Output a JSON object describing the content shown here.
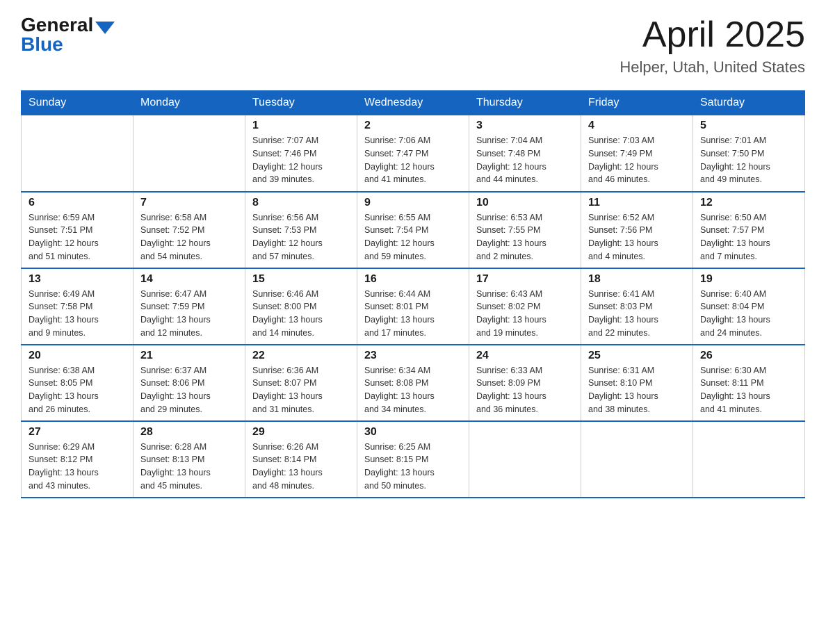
{
  "logo": {
    "general": "General",
    "blue": "Blue"
  },
  "title": {
    "month": "April 2025",
    "location": "Helper, Utah, United States"
  },
  "weekdays": [
    "Sunday",
    "Monday",
    "Tuesday",
    "Wednesday",
    "Thursday",
    "Friday",
    "Saturday"
  ],
  "weeks": [
    [
      {
        "day": "",
        "info": ""
      },
      {
        "day": "",
        "info": ""
      },
      {
        "day": "1",
        "info": "Sunrise: 7:07 AM\nSunset: 7:46 PM\nDaylight: 12 hours\nand 39 minutes."
      },
      {
        "day": "2",
        "info": "Sunrise: 7:06 AM\nSunset: 7:47 PM\nDaylight: 12 hours\nand 41 minutes."
      },
      {
        "day": "3",
        "info": "Sunrise: 7:04 AM\nSunset: 7:48 PM\nDaylight: 12 hours\nand 44 minutes."
      },
      {
        "day": "4",
        "info": "Sunrise: 7:03 AM\nSunset: 7:49 PM\nDaylight: 12 hours\nand 46 minutes."
      },
      {
        "day": "5",
        "info": "Sunrise: 7:01 AM\nSunset: 7:50 PM\nDaylight: 12 hours\nand 49 minutes."
      }
    ],
    [
      {
        "day": "6",
        "info": "Sunrise: 6:59 AM\nSunset: 7:51 PM\nDaylight: 12 hours\nand 51 minutes."
      },
      {
        "day": "7",
        "info": "Sunrise: 6:58 AM\nSunset: 7:52 PM\nDaylight: 12 hours\nand 54 minutes."
      },
      {
        "day": "8",
        "info": "Sunrise: 6:56 AM\nSunset: 7:53 PM\nDaylight: 12 hours\nand 57 minutes."
      },
      {
        "day": "9",
        "info": "Sunrise: 6:55 AM\nSunset: 7:54 PM\nDaylight: 12 hours\nand 59 minutes."
      },
      {
        "day": "10",
        "info": "Sunrise: 6:53 AM\nSunset: 7:55 PM\nDaylight: 13 hours\nand 2 minutes."
      },
      {
        "day": "11",
        "info": "Sunrise: 6:52 AM\nSunset: 7:56 PM\nDaylight: 13 hours\nand 4 minutes."
      },
      {
        "day": "12",
        "info": "Sunrise: 6:50 AM\nSunset: 7:57 PM\nDaylight: 13 hours\nand 7 minutes."
      }
    ],
    [
      {
        "day": "13",
        "info": "Sunrise: 6:49 AM\nSunset: 7:58 PM\nDaylight: 13 hours\nand 9 minutes."
      },
      {
        "day": "14",
        "info": "Sunrise: 6:47 AM\nSunset: 7:59 PM\nDaylight: 13 hours\nand 12 minutes."
      },
      {
        "day": "15",
        "info": "Sunrise: 6:46 AM\nSunset: 8:00 PM\nDaylight: 13 hours\nand 14 minutes."
      },
      {
        "day": "16",
        "info": "Sunrise: 6:44 AM\nSunset: 8:01 PM\nDaylight: 13 hours\nand 17 minutes."
      },
      {
        "day": "17",
        "info": "Sunrise: 6:43 AM\nSunset: 8:02 PM\nDaylight: 13 hours\nand 19 minutes."
      },
      {
        "day": "18",
        "info": "Sunrise: 6:41 AM\nSunset: 8:03 PM\nDaylight: 13 hours\nand 22 minutes."
      },
      {
        "day": "19",
        "info": "Sunrise: 6:40 AM\nSunset: 8:04 PM\nDaylight: 13 hours\nand 24 minutes."
      }
    ],
    [
      {
        "day": "20",
        "info": "Sunrise: 6:38 AM\nSunset: 8:05 PM\nDaylight: 13 hours\nand 26 minutes."
      },
      {
        "day": "21",
        "info": "Sunrise: 6:37 AM\nSunset: 8:06 PM\nDaylight: 13 hours\nand 29 minutes."
      },
      {
        "day": "22",
        "info": "Sunrise: 6:36 AM\nSunset: 8:07 PM\nDaylight: 13 hours\nand 31 minutes."
      },
      {
        "day": "23",
        "info": "Sunrise: 6:34 AM\nSunset: 8:08 PM\nDaylight: 13 hours\nand 34 minutes."
      },
      {
        "day": "24",
        "info": "Sunrise: 6:33 AM\nSunset: 8:09 PM\nDaylight: 13 hours\nand 36 minutes."
      },
      {
        "day": "25",
        "info": "Sunrise: 6:31 AM\nSunset: 8:10 PM\nDaylight: 13 hours\nand 38 minutes."
      },
      {
        "day": "26",
        "info": "Sunrise: 6:30 AM\nSunset: 8:11 PM\nDaylight: 13 hours\nand 41 minutes."
      }
    ],
    [
      {
        "day": "27",
        "info": "Sunrise: 6:29 AM\nSunset: 8:12 PM\nDaylight: 13 hours\nand 43 minutes."
      },
      {
        "day": "28",
        "info": "Sunrise: 6:28 AM\nSunset: 8:13 PM\nDaylight: 13 hours\nand 45 minutes."
      },
      {
        "day": "29",
        "info": "Sunrise: 6:26 AM\nSunset: 8:14 PM\nDaylight: 13 hours\nand 48 minutes."
      },
      {
        "day": "30",
        "info": "Sunrise: 6:25 AM\nSunset: 8:15 PM\nDaylight: 13 hours\nand 50 minutes."
      },
      {
        "day": "",
        "info": ""
      },
      {
        "day": "",
        "info": ""
      },
      {
        "day": "",
        "info": ""
      }
    ]
  ]
}
